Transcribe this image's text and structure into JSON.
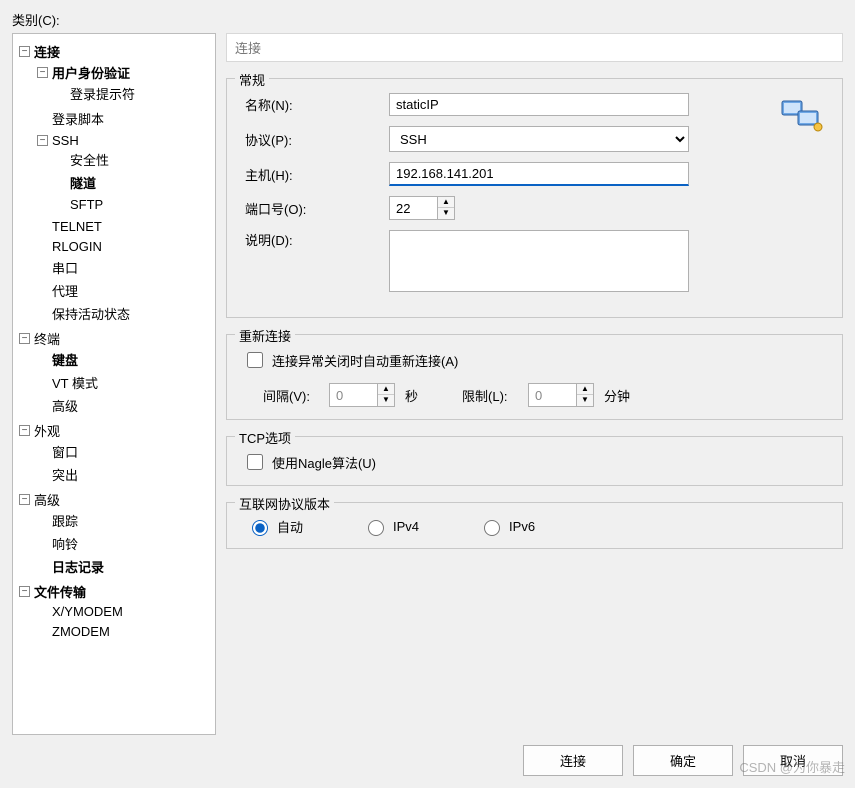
{
  "labels": {
    "category": "类别(C):",
    "header": "连接",
    "group_general": "常规",
    "name": "名称(N):",
    "protocol": "协议(P):",
    "host": "主机(H):",
    "port": "端口号(O):",
    "description": "说明(D):",
    "group_reconnect": "重新连接",
    "auto_reconnect": "连接异常关闭时自动重新连接(A)",
    "interval": "间隔(V):",
    "seconds": "秒",
    "limit": "限制(L):",
    "minutes": "分钟",
    "group_tcp": "TCP选项",
    "nagle": "使用Nagle算法(U)",
    "group_ipver": "互联网协议版本",
    "ip_auto": "自动",
    "ip_v4": "IPv4",
    "ip_v6": "IPv6",
    "btn_connect": "连接",
    "btn_ok": "确定",
    "btn_cancel": "取消"
  },
  "values": {
    "name": "staticIP",
    "protocol": "SSH",
    "host": "192.168.141.201",
    "port": "22",
    "description": "",
    "interval": "0",
    "limit": "0"
  },
  "tree": {
    "connection": "连接",
    "user_auth": "用户身份验证",
    "login_prompt": "登录提示符",
    "login_script": "登录脚本",
    "ssh": "SSH",
    "security": "安全性",
    "tunnel": "隧道",
    "sftp": "SFTP",
    "telnet": "TELNET",
    "rlogin": "RLOGIN",
    "serial": "串口",
    "proxy": "代理",
    "keepalive": "保持活动状态",
    "terminal": "终端",
    "keyboard": "键盘",
    "vtmode": "VT 模式",
    "advanced_term": "高级",
    "appearance": "外观",
    "window": "窗口",
    "highlight": "突出",
    "advanced": "高级",
    "trace": "跟踪",
    "bell": "响铃",
    "logging": "日志记录",
    "file_transfer": "文件传输",
    "xymodem": "X/YMODEM",
    "zmodem": "ZMODEM"
  },
  "watermark": "CSDN @为你暴走"
}
